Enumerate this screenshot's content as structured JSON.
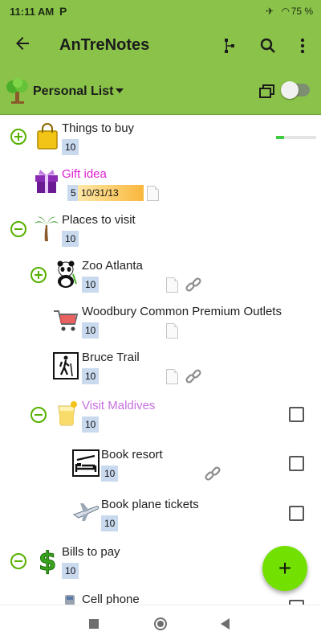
{
  "status_bar": {
    "time": "11:11 AM",
    "app_glyph": "P",
    "battery": "75 %"
  },
  "app_bar": {
    "title": "AnTreNotes"
  },
  "toolbar": {
    "list_name": "Personal List"
  },
  "items": [
    {
      "label": "Things to buy",
      "badge": "10",
      "progress": 0.2
    },
    {
      "label": "Gift idea",
      "badge": "5",
      "date": "10/31/13",
      "label_color": "#e020d0"
    },
    {
      "label": "Places to visit",
      "badge": "10"
    },
    {
      "label": "Zoo Atlanta",
      "badge": "10"
    },
    {
      "label": "Woodbury Common Premium Outlets",
      "badge": "10"
    },
    {
      "label": "Bruce Trail",
      "badge": "10"
    },
    {
      "label": "Visit Maldives",
      "badge": "10",
      "label_color": "#c66fe0"
    },
    {
      "label": "Book resort",
      "badge": "10"
    },
    {
      "label": "Book plane tickets",
      "badge": "10"
    },
    {
      "label": "Bills to pay",
      "badge": "10"
    },
    {
      "label": "Cell phone"
    }
  ],
  "fab": {
    "label": "+"
  },
  "colors": {
    "accent": "#8bc34a",
    "fab": "#72e000",
    "expand": "#56b000"
  }
}
